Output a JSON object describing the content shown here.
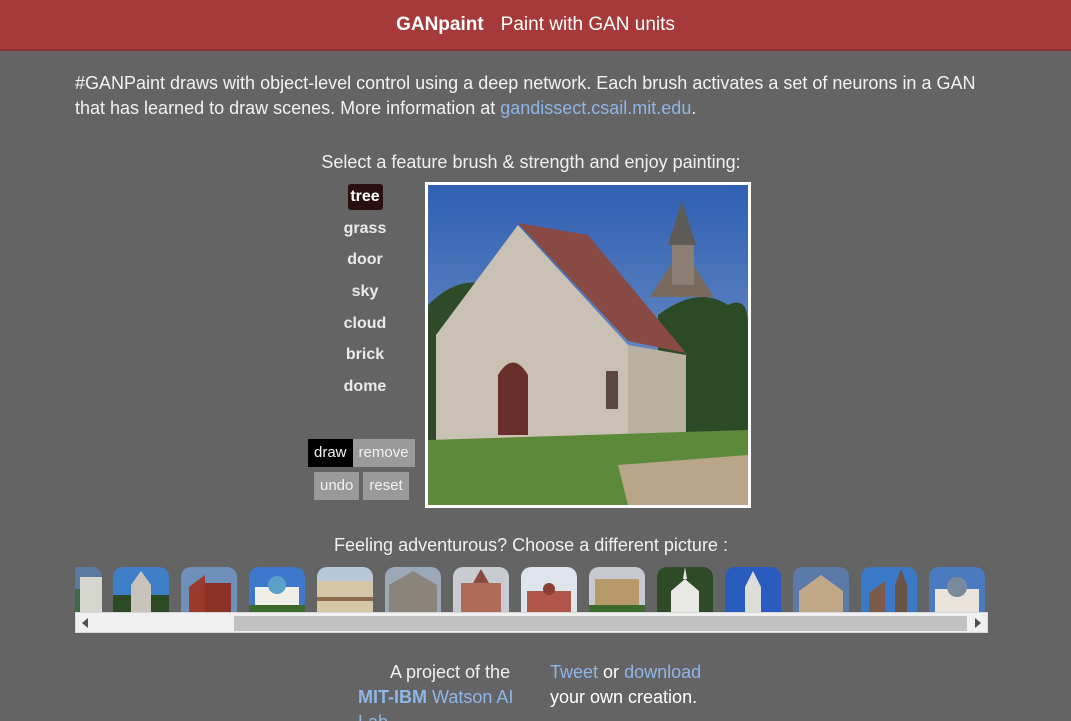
{
  "header": {
    "brand": "GANpaint",
    "tagline": "Paint with GAN units"
  },
  "intro": {
    "text": "#GANPaint draws with object-level control using a deep network. Each brush activates a set of neurons in a GAN that has learned to draw scenes. More information at ",
    "link": "gandissect.csail.mit.edu",
    "end": "."
  },
  "select_title": "Select a feature brush & strength and enjoy painting:",
  "brushes": [
    "tree",
    "grass",
    "door",
    "sky",
    "cloud",
    "brick",
    "dome"
  ],
  "modes": {
    "draw": "draw",
    "remove": "remove"
  },
  "actions": {
    "undo": "undo",
    "reset": "reset"
  },
  "feeling": "Feeling adventurous? Choose a different picture :",
  "footer": {
    "project_prefix": "A project of the",
    "lab_bold": "MIT-IBM",
    "lab_rest": "Watson AI Lab",
    "tweet": "Tweet",
    "or": "or",
    "download": "download",
    "creation": "your own creation."
  },
  "colors": {
    "header": "#a63a3a",
    "background": "#646464",
    "link": "#8fb6e8",
    "active_brush": "#2a0f10"
  }
}
